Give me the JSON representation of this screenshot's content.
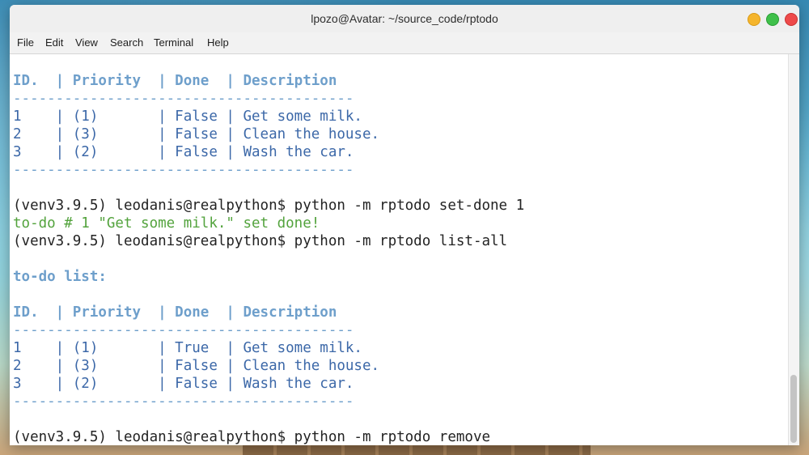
{
  "window": {
    "title": "lpozo@Avatar: ~/source_code/rptodo"
  },
  "menu": [
    "File",
    "Edit",
    "View",
    "Search",
    "Terminal",
    "Help"
  ],
  "terminal": {
    "lines": [
      {
        "text": "",
        "kind": "blank"
      },
      {
        "text": "ID.  | Priority  | Done  | Description",
        "kind": "header"
      },
      {
        "text": "----------------------------------------",
        "kind": "sep"
      },
      {
        "text": "1    | (1)       | False | Get some milk.",
        "kind": "row"
      },
      {
        "text": "2    | (3)       | False | Clean the house.",
        "kind": "row"
      },
      {
        "text": "3    | (2)       | False | Wash the car.",
        "kind": "row"
      },
      {
        "text": "----------------------------------------",
        "kind": "sep"
      },
      {
        "text": "",
        "kind": "blank"
      },
      {
        "text": "(venv3.9.5) leodanis@realpython$ python -m rptodo set-done 1",
        "kind": "prompt"
      },
      {
        "text": "to-do # 1 \"Get some milk.\" set done!",
        "kind": "success"
      },
      {
        "text": "(venv3.9.5) leodanis@realpython$ python -m rptodo list-all",
        "kind": "prompt"
      },
      {
        "text": "",
        "kind": "blank"
      },
      {
        "text": "to-do list:",
        "kind": "header"
      },
      {
        "text": "",
        "kind": "blank"
      },
      {
        "text": "ID.  | Priority  | Done  | Description",
        "kind": "header"
      },
      {
        "text": "----------------------------------------",
        "kind": "sep"
      },
      {
        "text": "1    | (1)       | True  | Get some milk.",
        "kind": "row"
      },
      {
        "text": "2    | (3)       | False | Clean the house.",
        "kind": "row"
      },
      {
        "text": "3    | (2)       | False | Wash the car.",
        "kind": "row"
      },
      {
        "text": "----------------------------------------",
        "kind": "sep"
      },
      {
        "text": "",
        "kind": "blank"
      },
      {
        "text": "(venv3.9.5) leodanis@realpython$ python -m rptodo remove",
        "kind": "prompt"
      }
    ]
  },
  "colors": {
    "header": "#6e9fcb",
    "row": "#3c68a8",
    "prompt": "#232323",
    "success": "#53a33d"
  }
}
